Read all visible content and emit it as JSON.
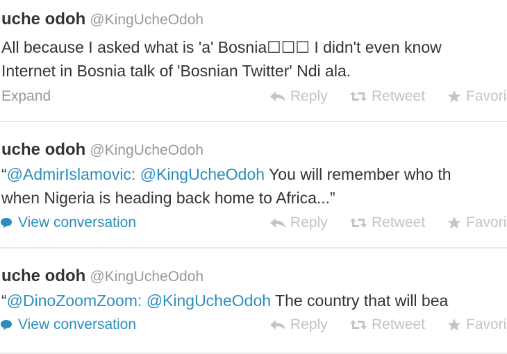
{
  "tweets": [
    {
      "name": "uche odoh",
      "handle": "@KingUcheOdoh",
      "line1": "All because I asked what is 'a' Bosnia☐☐☐ I didn't even know",
      "line2": "Internet in Bosnia talk of 'Bosnian Twitter' Ndi ala.",
      "footer": "Expand",
      "reply": "Reply",
      "retweet": "Retweet",
      "favorite": "Favori"
    },
    {
      "name": "uche odoh",
      "handle": "@KingUcheOdoh",
      "quote_open": "“",
      "mention1": "@AdmirIslamovic:",
      "mention2": "@KingUcheOdoh",
      "line1_rest": "You will remember who th",
      "line2": "when Nigeria is heading back home to Africa...”",
      "footer": "View conversation",
      "reply": "Reply",
      "retweet": "Retweet",
      "favorite": "Favori"
    },
    {
      "name": "uche odoh",
      "handle": "@KingUcheOdoh",
      "quote_open": "“",
      "mention1": "@DinoZoomZoom:",
      "mention2": "@KingUcheOdoh",
      "line1_rest": "The country that will bea",
      "footer": "View conversation",
      "reply": "Reply",
      "retweet": "Retweet",
      "favorite": "Favori"
    }
  ],
  "colors": {
    "link": "#2a8fbd",
    "muted": "#999999",
    "action": "#c4c4c4",
    "text": "#333333"
  },
  "icons": {
    "reply": "reply-arrow-icon",
    "retweet": "retweet-icon",
    "favorite": "star-icon",
    "conversation": "speech-bubble-icon"
  }
}
